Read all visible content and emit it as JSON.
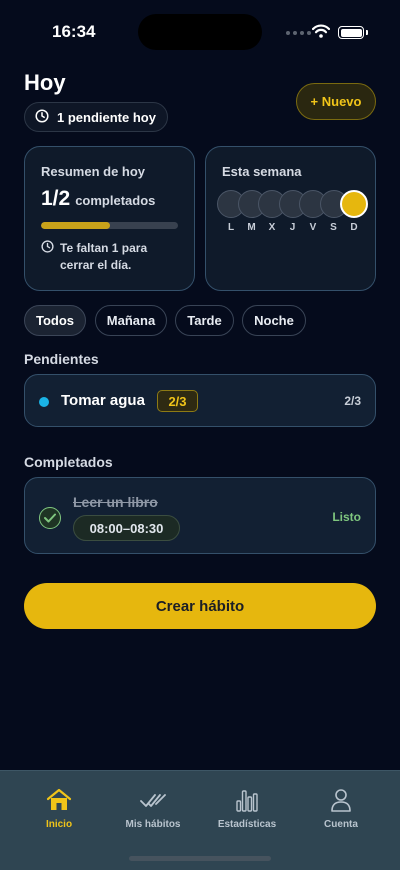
{
  "status_bar": {
    "time": "16:34"
  },
  "header": {
    "title": "Hoy",
    "pending_chip": "1 pendiente hoy",
    "new_button": "+ Nuevo"
  },
  "summary": {
    "title": "Resumen de hoy",
    "count": "1/2",
    "count_label": "completados",
    "progress": 0.5,
    "note": "Te faltan 1 para cerrar el día."
  },
  "week": {
    "title": "Esta semana",
    "days": [
      "L",
      "M",
      "X",
      "J",
      "V",
      "S",
      "D"
    ],
    "active_day": "D"
  },
  "filters": [
    {
      "label": "Todos",
      "active": true
    },
    {
      "label": "Mañana",
      "active": false
    },
    {
      "label": "Tarde",
      "active": false
    },
    {
      "label": "Noche",
      "active": false
    }
  ],
  "pending": {
    "section_title": "Pendientes",
    "items": [
      {
        "name": "Tomar agua",
        "badge": "2/3",
        "count": "2/3",
        "dot_color": "#1ab3e6"
      }
    ]
  },
  "completed": {
    "section_title": "Completados",
    "items": [
      {
        "name": "Leer un libro",
        "time": "08:00–08:30",
        "status": "Listo"
      }
    ]
  },
  "create_button": "Crear hábito",
  "tab_bar": {
    "items": [
      {
        "label": "Inicio",
        "icon": "home-icon",
        "active": true
      },
      {
        "label": "Mis hábitos",
        "icon": "checks-icon",
        "active": false
      },
      {
        "label": "Estadísticas",
        "icon": "bar-chart-icon",
        "active": false
      },
      {
        "label": "Cuenta",
        "icon": "user-icon",
        "active": false
      }
    ]
  },
  "colors": {
    "accent": "#e6b70e",
    "background": "#050b1c",
    "success": "#7fc67f",
    "tab_bar": "#2f4552"
  }
}
